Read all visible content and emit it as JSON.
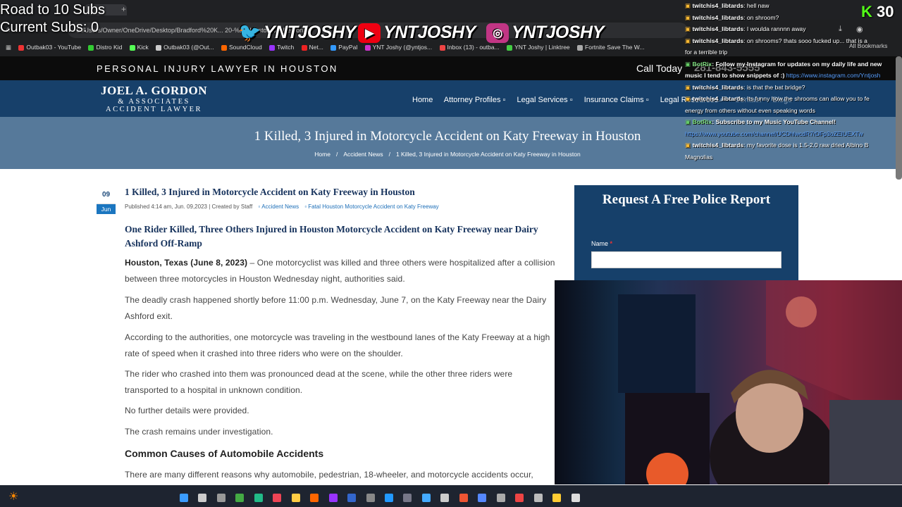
{
  "overlay": {
    "road": "Road to 10 Subs",
    "current": "Current Subs: 0",
    "handles": [
      "YNTJOSHY",
      "YNTJOSHY",
      "YNTJOSHY"
    ]
  },
  "browser": {
    "url": "C:/Users/Owner/OneDrive/Desktop/Bradford%20K...   20-%20Houston%20Personal",
    "bookmarks": [
      "Outbak03 - YouTube",
      "Distro Kid",
      "Kick",
      "Outbak03 (@Out...",
      "SoundCloud",
      "Twitch",
      "Net...",
      "PayPal",
      "YNT Joshy (@yntjos...",
      "Inbox (13) - outba...",
      "YNT Joshy | Linktree",
      "Fortnite Save The W...",
      "All Bookmarks"
    ]
  },
  "site": {
    "topbar_left": "PERSONAL INJURY LAWYER IN HOUSTON",
    "topbar_right": "Call Today",
    "phone": "281-843-5555",
    "logo": {
      "line1": "JOEL A. GORDON",
      "line2": "& ASSOCIATES",
      "line3": "ACCIDENT LAWYER"
    },
    "nav": [
      "Home",
      "Attorney Profiles ▫",
      "Legal Services ▫",
      "Insurance Claims ▫",
      "Legal Resources ▫",
      "Contact",
      "Blogs"
    ],
    "hero_title": "1 Killed, 3 Injured in Motorcycle Accident on Katy Freeway in Houston",
    "breadcrumb": [
      "Home",
      "/",
      "Accident News",
      "/",
      "1 Killed, 3 Injured in Motorcycle Accident on Katy Freeway in Houston"
    ]
  },
  "article": {
    "date_day": "09",
    "date_month": "Jun",
    "title": "1 Killed, 3 Injured in Motorcycle Accident on Katy Freeway in Houston",
    "meta": "Published 4:14 am, Jun. 09,2023 | Created by Staff",
    "cat1": "Accident News",
    "cat2": "Fatal Houston Motorcycle Accident on Katy Freeway",
    "subhead": "One Rider Killed, Three Others Injured in Houston Motorcycle Accident on Katy Freeway near Dairy Ashford Off-Ramp",
    "lead_bold": "Houston, Texas (June 8, 2023)",
    "p1": " – One motorcyclist was killed and three others were hospitalized after a collision between three motorcycles in Houston Wednesday night, authorities said.",
    "p2": "The deadly crash happened shortly before 11:00 p.m. Wednesday, June 7, on the Katy Freeway near the Dairy Ashford exit.",
    "p3": "According to the authorities, one motorcycle was traveling in the westbound lanes of the Katy Freeway at a high rate of speed when it crashed into three riders who were on the shoulder.",
    "p4": "The rider who crashed into them was pronounced dead at the scene, while the other three riders were transported to a hospital in unknown condition.",
    "p5": "No further details were provided.",
    "p6": "The crash remains under investigation.",
    "h2": "Common Causes of Automobile Accidents",
    "p7": "There are many different reasons why automobile, pedestrian, 18-wheeler, and motorcycle accidents occur,"
  },
  "form": {
    "title": "Request A Free Police Report",
    "name_label": "Name",
    "required": "*"
  },
  "chat": [
    {
      "user": "twitchis4_libtards",
      "text": ": hell naw"
    },
    {
      "user": "twitchis4_libtards",
      "text": ": on shroom?"
    },
    {
      "user": "twitchis4_libtards",
      "text": ": I woulda rannnn away"
    },
    {
      "user": "twitchis4_libtards",
      "text": ": on shrooms? thats sooo fucked up... that is a"
    },
    {
      "user": "",
      "text": "for a terrible trip"
    },
    {
      "user": "BotRix",
      "text": ": Follow my Instagram for updates on my daily life and new"
    },
    {
      "user": "",
      "text": "music I tend to show snippets of :)",
      "link": " https://www.instagram.com/Yntjosh"
    },
    {
      "user": "twitchis4_libtards",
      "text": ": is that the bat bridge?"
    },
    {
      "user": "twitchis4_libtards",
      "text": ": Its funny how the shrooms can allow you to fe"
    },
    {
      "user": "",
      "text": "energy from others without even speaking words"
    },
    {
      "user": "BotRix",
      "text": ": Subscribe to my Music YouTube Channel!"
    },
    {
      "user": "",
      "text": "",
      "link": "https://www.youtube.com/channel/UCDhlwcdR7rDFp3oZEIUEXTw"
    },
    {
      "user": "twitchis4_libtards",
      "text": ": my favorite dose is 1.5-2.0 raw dried Albino B"
    },
    {
      "user": "",
      "text": "Magnolias"
    }
  ],
  "kick_count": "30",
  "colors": {
    "navy": "#17406a",
    "hero": "#56799a",
    "link": "#1d6fb8",
    "date_blue": "#1b76c0"
  }
}
